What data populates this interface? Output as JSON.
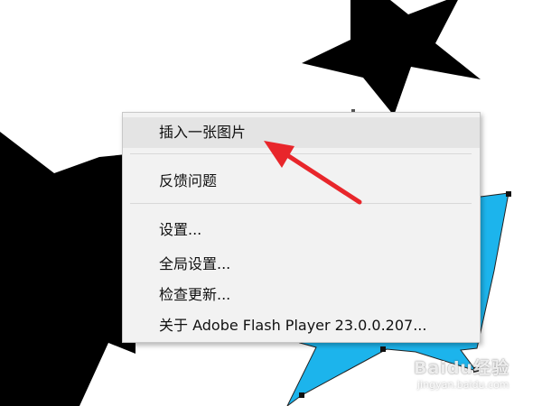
{
  "context_menu": {
    "items": [
      {
        "label": "插入一张图片",
        "highlighted": true
      },
      {
        "label": "反馈问题"
      },
      {
        "label": "设置..."
      },
      {
        "label": "全局设置..."
      },
      {
        "label": "检查更新..."
      },
      {
        "label": "关于 Adobe Flash Player 23.0.0.207..."
      }
    ]
  },
  "watermark": {
    "logo": "Baidu经验",
    "url": "jingyan.baidu.com"
  },
  "colors": {
    "star_fill": "#000000",
    "selected_star_fill": "#1cb4ec",
    "annotation_arrow": "#e8262b",
    "menu_background": "#f2f2f2",
    "menu_highlight": "#e4e4e4"
  }
}
